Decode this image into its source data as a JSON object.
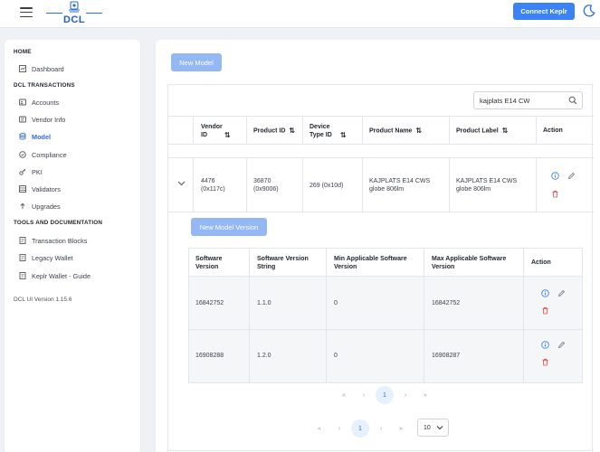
{
  "app": {
    "logo_text": "DCL",
    "connect_button": "Connect Keplr"
  },
  "sidebar": {
    "sections": [
      {
        "title": "HOME"
      },
      {
        "title": "DCL TRANSACTIONS"
      },
      {
        "title": "TOOLS AND DOCUMENTATION"
      }
    ],
    "items": [
      {
        "label": "Dashboard",
        "icon": "dashboard-icon"
      },
      {
        "label": "Accounts",
        "icon": "accounts-icon"
      },
      {
        "label": "Vendor Info",
        "icon": "vendor-icon"
      },
      {
        "label": "Model",
        "icon": "database-icon",
        "active": true
      },
      {
        "label": "Compliance",
        "icon": "compliance-icon"
      },
      {
        "label": "PKI",
        "icon": "key-icon"
      },
      {
        "label": "Validators",
        "icon": "validators-icon"
      },
      {
        "label": "Upgrades",
        "icon": "upgrades-icon"
      },
      {
        "label": "Transaction Blocks",
        "icon": "document-icon"
      },
      {
        "label": "Legacy Wallet",
        "icon": "document-icon"
      },
      {
        "label": "Keplr Wallet - Guide",
        "icon": "document-icon"
      }
    ],
    "version": "DCL UI Version 1.15.6"
  },
  "main": {
    "new_model_button": "New Model",
    "search_value": "kajplats E14 CW",
    "columns": [
      "Vendor ID",
      "Product ID",
      "Device Type ID",
      "Product Name",
      "Product Label",
      "Action"
    ],
    "row": {
      "vendor_id": "4476",
      "vendor_id_hex": "(0x117c)",
      "product_id": "36870",
      "product_id_hex": "(0x9006)",
      "device_type": "269 (0x10d)",
      "product_name_1": "KAJPLATS E14 CWS",
      "product_name_2": "globe 806lm",
      "product_label_1": "KAJPLATS E14 CWS",
      "product_label_2": "globe 806lm"
    },
    "new_model_version_button": "New Model Version",
    "version_columns": [
      "Software Version",
      "Software Version String",
      "Min Applicable Software Version",
      "Max Applicable Software Version",
      "Action"
    ],
    "versions": [
      {
        "software_version": "16842752",
        "version_string": "1.1.0",
        "min": "0",
        "max": "16842752"
      },
      {
        "software_version": "16908288",
        "version_string": "1.2.0",
        "min": "0",
        "max": "16908287"
      }
    ],
    "inner_pager": {
      "first": "«",
      "prev": "‹",
      "current": "1",
      "next": "›",
      "last": "»"
    },
    "outer_pager": {
      "first": "«",
      "prev": "‹",
      "current": "1",
      "next": "›",
      "last": "»"
    },
    "page_size": "10"
  },
  "colors": {
    "accent": "#3b82f6",
    "accent_light": "#93b8f3",
    "info": "#3b82f6",
    "danger": "#ef4444"
  }
}
